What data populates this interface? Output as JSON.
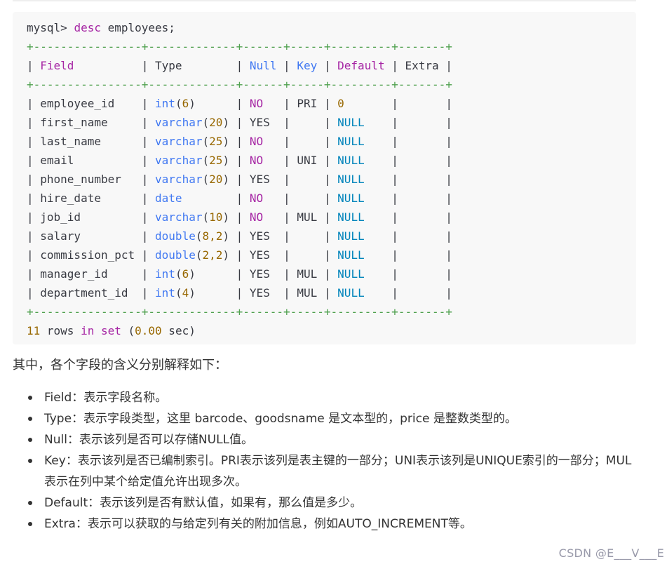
{
  "code": {
    "command_prompt": "mysql> ",
    "command_kw": "desc",
    "command_rest": " employees;",
    "border_line": "+----------------+-------------+------+-----+---------+-------+",
    "headers": {
      "field": "Field",
      "type": "Type",
      "null": "Null",
      "key": "Key",
      "default": "Default",
      "extra": "Extra"
    },
    "rows": [
      {
        "field": "employee_id",
        "type": "int",
        "len": "6",
        "null": "NO",
        "key": "PRI",
        "default": "0",
        "extra": ""
      },
      {
        "field": "first_name",
        "type": "varchar",
        "len": "20",
        "null": "YES",
        "key": "",
        "default": "NULL",
        "extra": ""
      },
      {
        "field": "last_name",
        "type": "varchar",
        "len": "25",
        "null": "NO",
        "key": "",
        "default": "NULL",
        "extra": ""
      },
      {
        "field": "email",
        "type": "varchar",
        "len": "25",
        "null": "NO",
        "key": "UNI",
        "default": "NULL",
        "extra": ""
      },
      {
        "field": "phone_number",
        "type": "varchar",
        "len": "20",
        "null": "YES",
        "key": "",
        "default": "NULL",
        "extra": ""
      },
      {
        "field": "hire_date",
        "type": "date",
        "len": "",
        "null": "NO",
        "key": "",
        "default": "NULL",
        "extra": ""
      },
      {
        "field": "job_id",
        "type": "varchar",
        "len": "10",
        "null": "NO",
        "key": "MUL",
        "default": "NULL",
        "extra": ""
      },
      {
        "field": "salary",
        "type": "double",
        "len": "8,2",
        "null": "YES",
        "key": "",
        "default": "NULL",
        "extra": ""
      },
      {
        "field": "commission_pct",
        "type": "double",
        "len": "2,2",
        "null": "YES",
        "key": "",
        "default": "NULL",
        "extra": ""
      },
      {
        "field": "manager_id",
        "type": "int",
        "len": "6",
        "null": "YES",
        "key": "MUL",
        "default": "NULL",
        "extra": ""
      },
      {
        "field": "department_id",
        "type": "int",
        "len": "4",
        "null": "YES",
        "key": "MUL",
        "default": "NULL",
        "extra": ""
      }
    ],
    "footer": {
      "count": "11",
      "rows_word": " rows ",
      "in_kw": "in",
      "set_kw": "set",
      "time_open": " (",
      "time": "0.00",
      "time_close": " sec)"
    }
  },
  "intro": "其中，各个字段的含义分别解释如下：",
  "items": [
    {
      "text": "Field：表示字段名称。"
    },
    {
      "text": "Type：表示字段类型，这里 barcode、goodsname 是文本型的，price 是整数类型的。"
    },
    {
      "text": "Null：表示该列是否可以存储NULL值。"
    },
    {
      "text": "Key：表示该列是否已编制索引。PRI表示该列是表主键的一部分；UNI表示该列是UNIQUE索引的一部分；MUL表示在列中某个给定值允许出现多次。"
    },
    {
      "text": "Default：表示该列是否有默认值，如果有，那么值是多少。"
    },
    {
      "text": "Extra：表示可以获取的与给定列有关的附加信息，例如AUTO_INCREMENT等。"
    }
  ],
  "watermark": "CSDN @E___V___E"
}
